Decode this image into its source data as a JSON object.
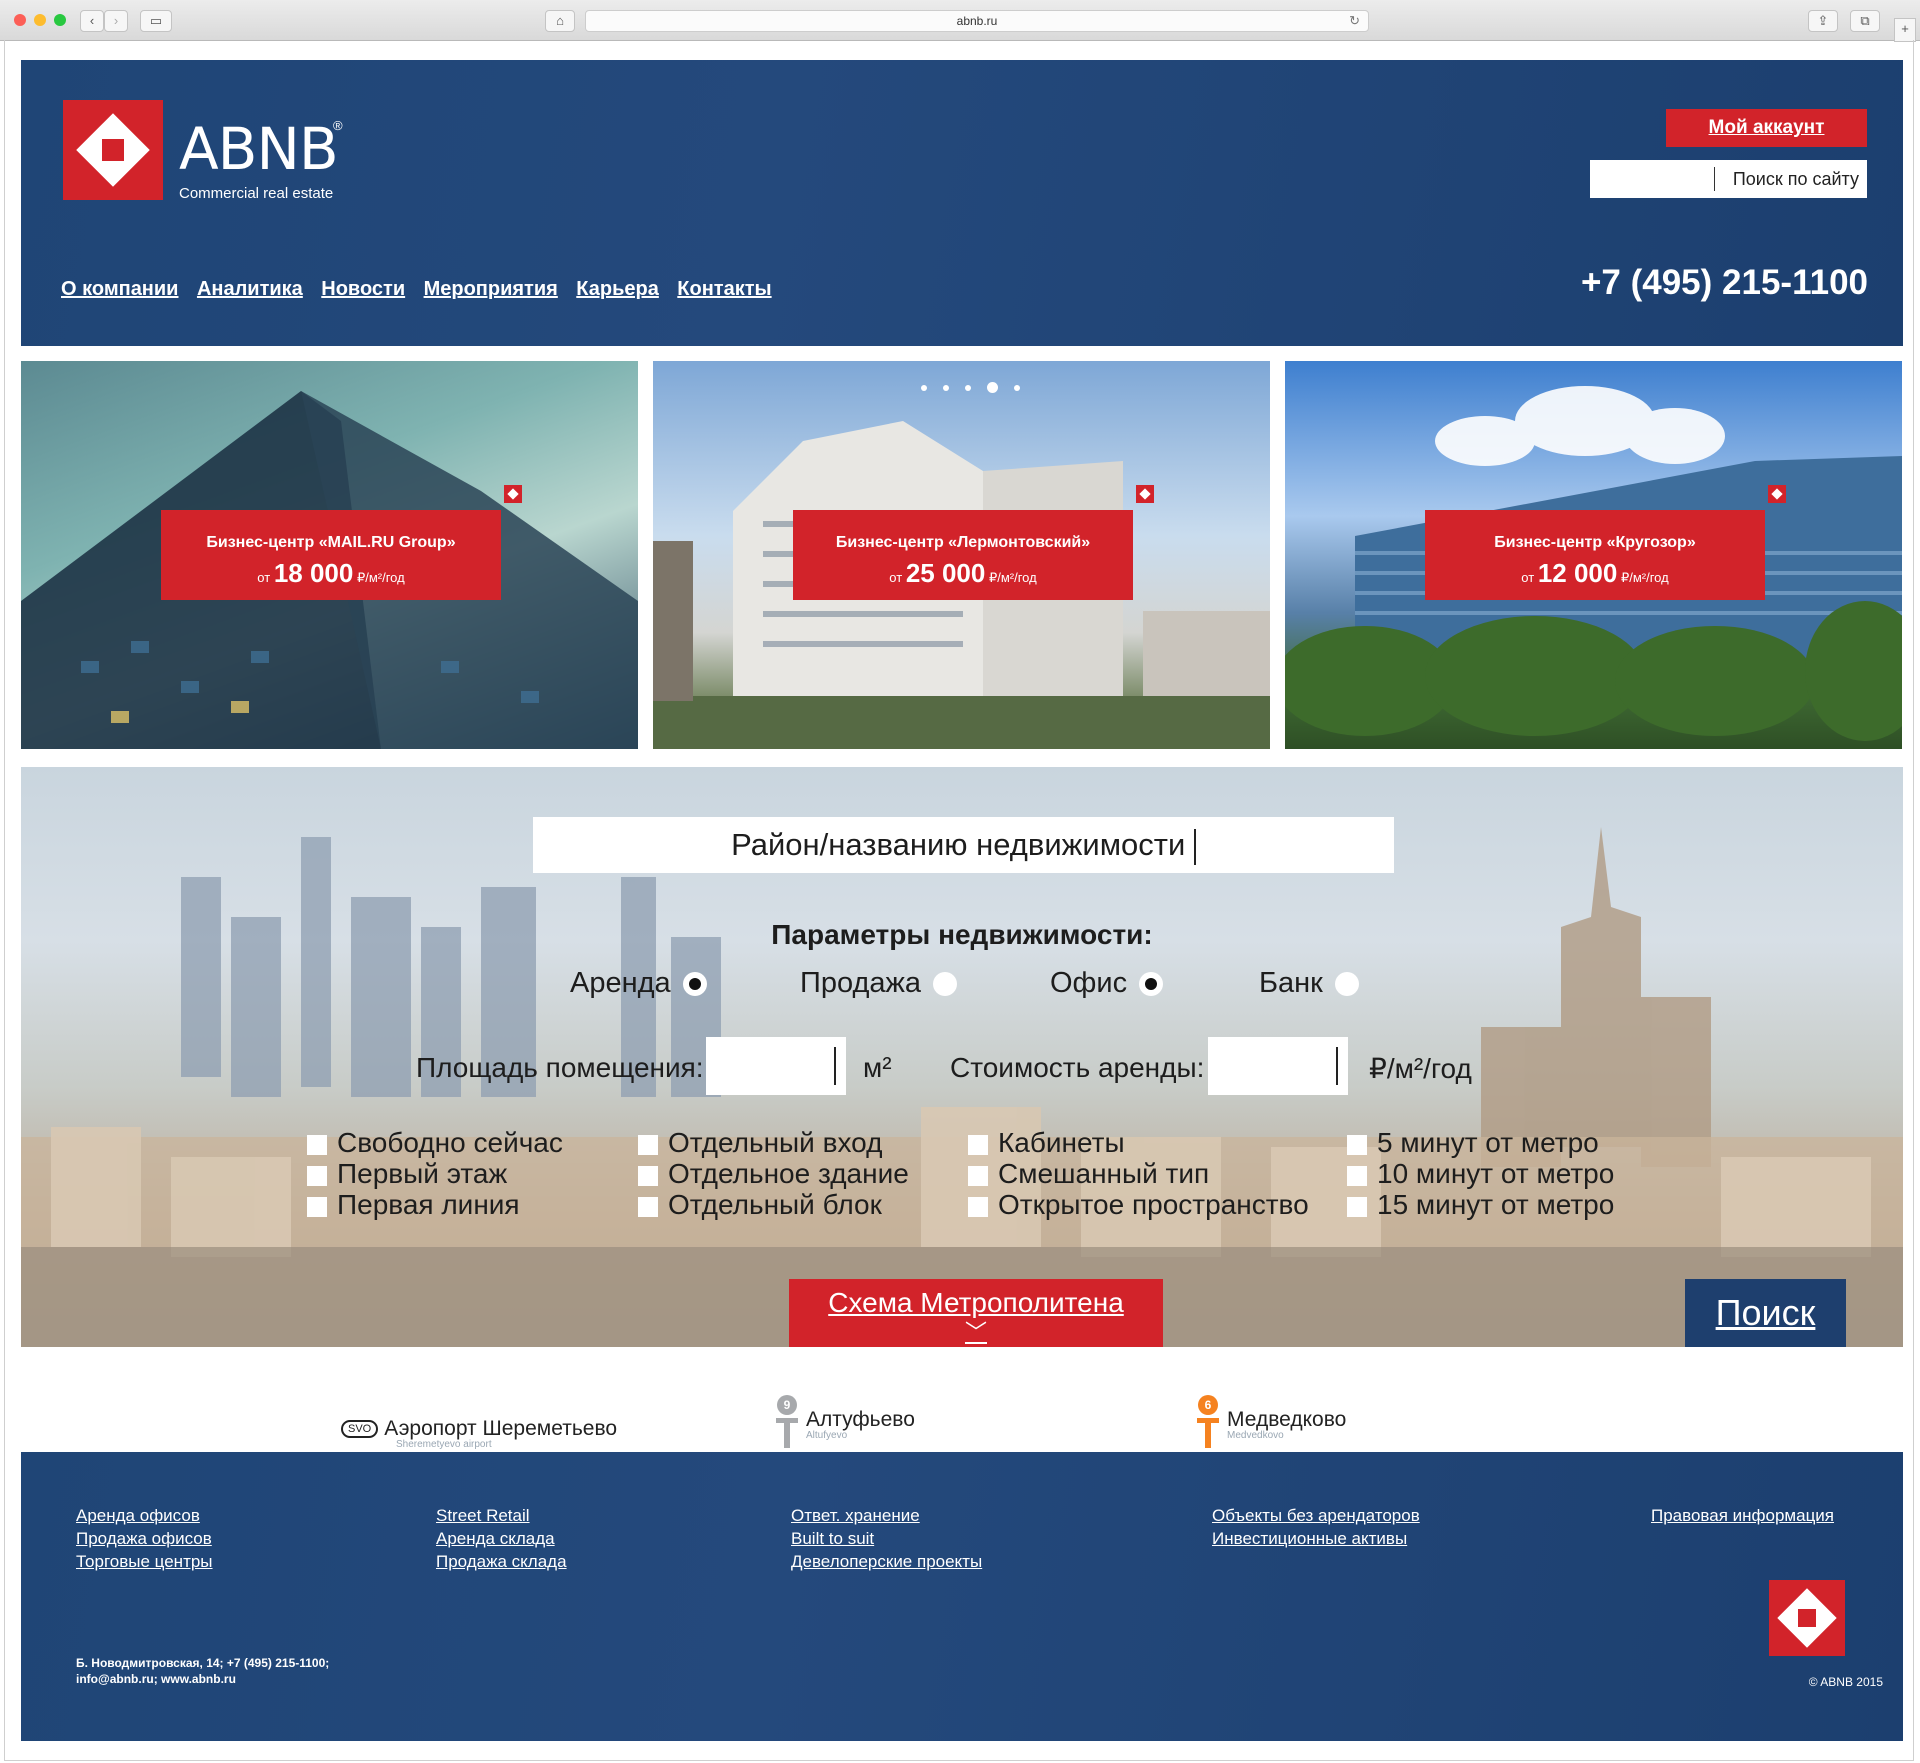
{
  "browser": {
    "url": "abnb.ru"
  },
  "header": {
    "logo_text": "ABNB",
    "logo_reg": "®",
    "logo_subtitle": "Commercial real estate",
    "account_button": "Мой аккаунт",
    "site_search_placeholder": "Поиск по сайту",
    "phone": "+7 (495) 215-1100",
    "nav": [
      "О компании",
      "Аналитика",
      "Новости",
      "Мероприятия",
      "Карьера",
      "Контакты"
    ]
  },
  "hero": {
    "cards": [
      {
        "title": "Бизнес-центр «MAIL.RU Group»",
        "price_prefix": "от",
        "price": "18 000",
        "unit": "₽/м²/год"
      },
      {
        "title": "Бизнес-центр «Лермонтовский»",
        "price_prefix": "от",
        "price": "25 000",
        "unit": "₽/м²/год"
      },
      {
        "title": "Бизнес-центр «Кругозор»",
        "price_prefix": "от",
        "price": "12 000",
        "unit": "₽/м²/год"
      }
    ],
    "slider_active_index": 3,
    "slider_count": 5
  },
  "search": {
    "main_placeholder": "Район/названию недвижимости",
    "params_title": "Параметры недвижимости:",
    "radios": [
      {
        "label": "Аренда",
        "checked": true
      },
      {
        "label": "Продажа",
        "checked": false
      },
      {
        "label": "Офис",
        "checked": true
      },
      {
        "label": "Банк",
        "checked": false
      }
    ],
    "area_label": "Площадь помещения:",
    "area_unit": "м²",
    "cost_label": "Стоимость аренды:",
    "cost_unit": "₽/м²/год",
    "checkbox_columns": [
      [
        "Свободно сейчас",
        "Первый этаж",
        "Первая линия"
      ],
      [
        "Отдельный вход",
        "Отдельное здание",
        "Отдельный блок"
      ],
      [
        "Кабинеты",
        "Смешанный тип",
        "Открытое пространство"
      ],
      [
        "5 минут от метро",
        "10 минут от метро",
        "15 минут от метро"
      ]
    ],
    "metro_button": "Схема Метрополитена",
    "search_button": "Поиск"
  },
  "metro": {
    "stations": [
      {
        "name": "Аэропорт Шереметьево",
        "sub": "Sheremetyevo airport",
        "badge": "SVO"
      },
      {
        "name": "Алтуфьево",
        "sub": "Altufyevo",
        "line": "9",
        "color": "#a7a9ac"
      },
      {
        "name": "Медведково",
        "sub": "Medvedkovo",
        "line": "6",
        "color": "#f58220"
      }
    ]
  },
  "footer": {
    "columns": [
      [
        "Аренда офисов",
        "Продажа офисов",
        "Торговые центры"
      ],
      [
        "Street Retail",
        "Аренда склада",
        "Продажа склада"
      ],
      [
        "Ответ. хранение",
        "Built to suit",
        "Девелоперские проекты"
      ],
      [
        "Объекты без арендаторов",
        "Инвестиционные активы"
      ],
      [
        "Правовая информация"
      ]
    ],
    "address_line1": "Б. Новодмитровская, 14; +7 (495) 215-1100;",
    "address_line2": "info@abnb.ru; www.abnb.ru",
    "copyright": "© ABNB 2015"
  },
  "colors": {
    "brand_blue": "#1f4576",
    "brand_red": "#d2232a"
  }
}
